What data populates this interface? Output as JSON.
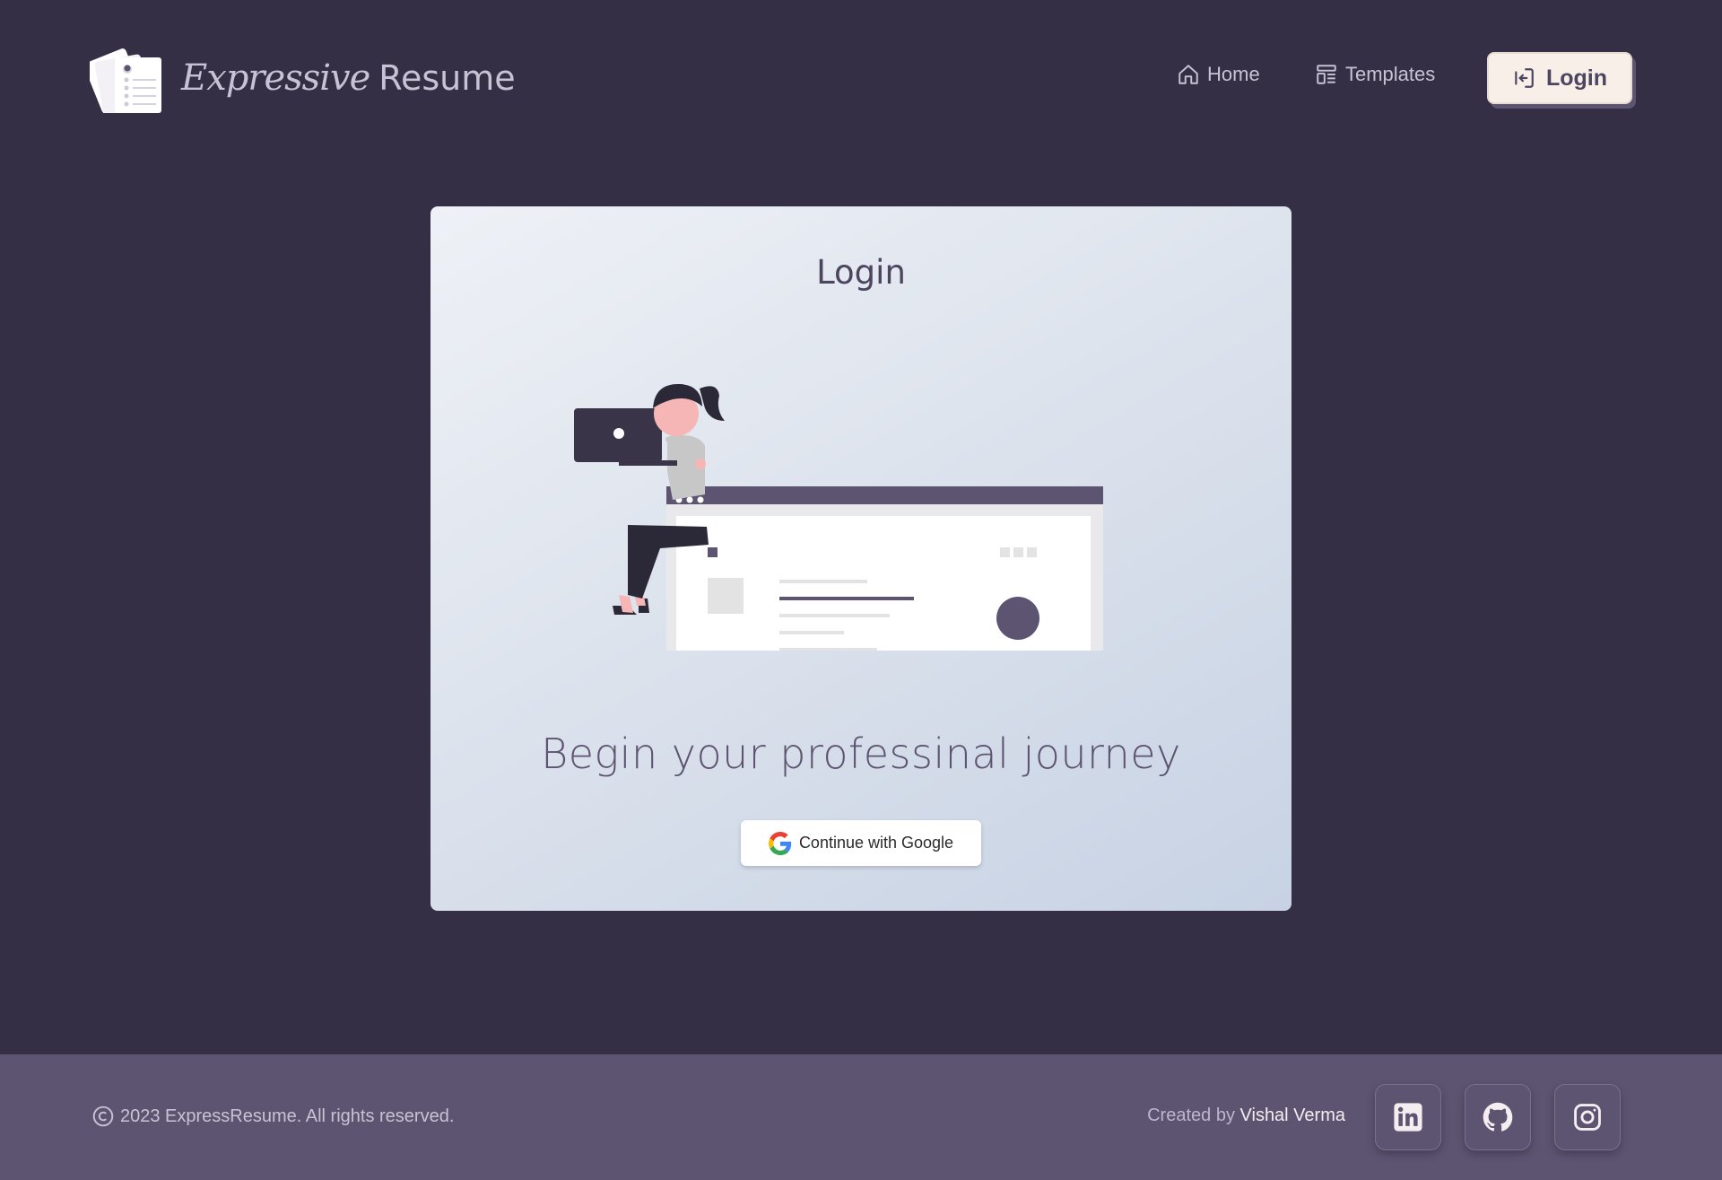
{
  "header": {
    "logo_script": "Expressive",
    "logo_word": "Resume",
    "nav": {
      "home_label": "Home",
      "templates_label": "Templates",
      "login_label": "Login"
    }
  },
  "card": {
    "title": "Login",
    "tagline": "Begin your professinal journey",
    "google_button_label": "Continue with Google"
  },
  "footer": {
    "copyright": "2023 ExpressResume. All rights reserved.",
    "credit_prefix": "Created by",
    "credit_name": "Vishal Verma",
    "social": [
      "linkedin-icon",
      "github-icon",
      "instagram-icon"
    ]
  },
  "colors": {
    "background": "#352f45",
    "footer": "#5d5471",
    "accent": "#5d5471",
    "login_button": "#f8efe8"
  }
}
